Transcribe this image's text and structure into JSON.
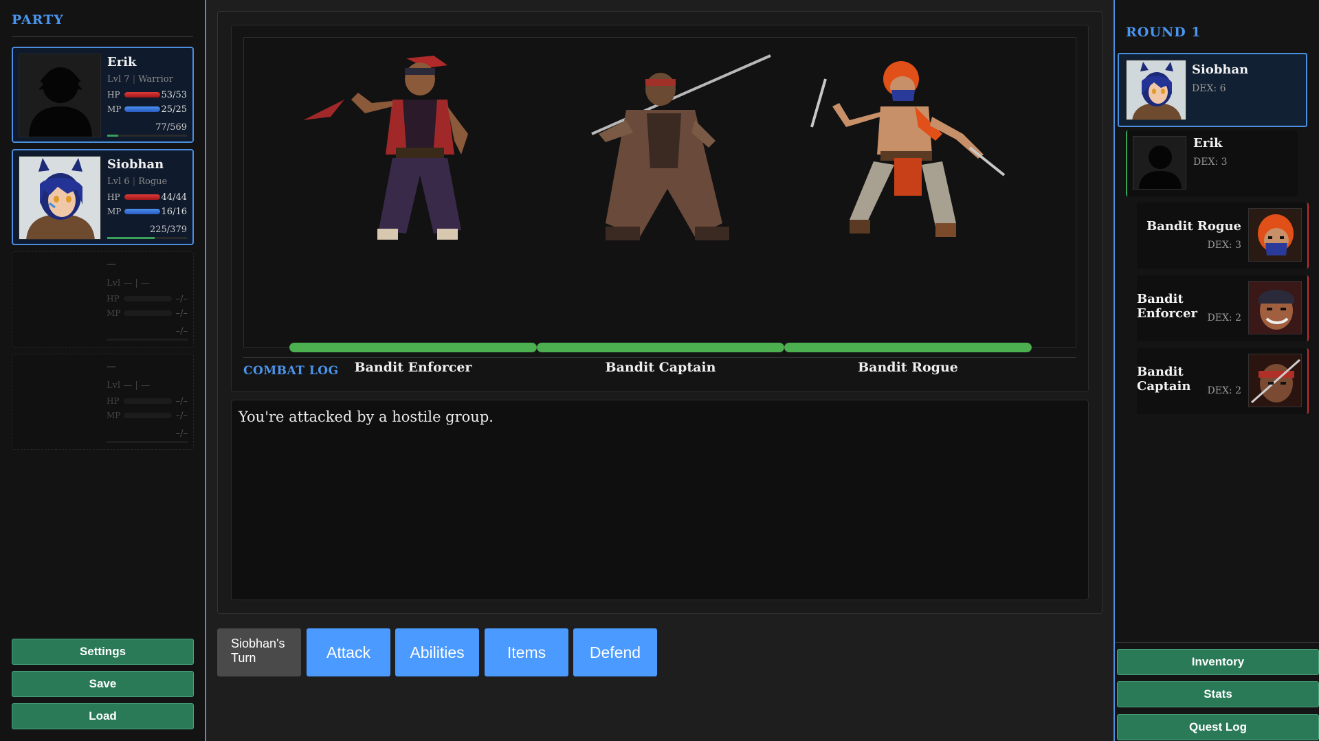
{
  "party": {
    "title": "PARTY",
    "members": [
      {
        "name": "Erik",
        "level": "Lvl 7",
        "class": "Warrior",
        "hp_label": "HP",
        "hp": "53/53",
        "hp_fill": 1.0,
        "mp_label": "MP",
        "mp": "25/25",
        "mp_fill": 1.0,
        "xp": "77/569",
        "xp_fill": 0.135
      },
      {
        "name": "Siobhan",
        "level": "Lvl 6",
        "class": "Rogue",
        "hp_label": "HP",
        "hp": "44/44",
        "hp_fill": 1.0,
        "mp_label": "MP",
        "mp": "16/16",
        "mp_fill": 1.0,
        "xp": "225/379",
        "xp_fill": 0.594
      },
      {
        "name": "—",
        "level": "Lvl —",
        "class": "—",
        "hp_label": "HP",
        "hp": "–/–",
        "mp_label": "MP",
        "mp": "–/–",
        "xp": "–/–"
      },
      {
        "name": "—",
        "level": "Lvl —",
        "class": "—",
        "hp_label": "HP",
        "hp": "–/–",
        "mp_label": "MP",
        "mp": "–/–",
        "xp": "–/–"
      }
    ]
  },
  "left_buttons": {
    "settings": "Settings",
    "save": "Save",
    "load": "Load"
  },
  "enemies": [
    {
      "name": "Bandit Enforcer",
      "hp_fill": 1.0,
      "icon": "bandit-enforcer-sprite"
    },
    {
      "name": "Bandit Captain",
      "hp_fill": 1.0,
      "icon": "bandit-captain-sprite"
    },
    {
      "name": "Bandit Rogue",
      "hp_fill": 1.0,
      "icon": "bandit-rogue-sprite"
    }
  ],
  "combat_log": {
    "title": "COMBAT LOG",
    "lines": [
      "You're attacked by a hostile group."
    ]
  },
  "actions": {
    "turn_label": "Siobhan's Turn",
    "attack": "Attack",
    "abilities": "Abilities",
    "items": "Items",
    "defend": "Defend"
  },
  "turn_order": {
    "round": "ROUND 1",
    "entries": [
      {
        "name": "Siobhan",
        "dex": "DEX: 6"
      },
      {
        "name": "Erik",
        "dex": "DEX: 3"
      },
      {
        "name": "Bandit Rogue",
        "dex": "DEX: 3"
      },
      {
        "name": "Bandit Enforcer",
        "dex": "DEX: 2"
      },
      {
        "name": "Bandit Captain",
        "dex": "DEX: 2"
      }
    ]
  },
  "right_buttons": {
    "inventory": "Inventory",
    "stats": "Stats",
    "quest_log": "Quest Log"
  },
  "colors": {
    "accent": "#4a95ee",
    "button_green": "#2a7a58",
    "action_blue": "#4a9aff",
    "hp_green": "#4caf50",
    "hp_red": "#d02a2a",
    "mp_blue": "#3a7ae0"
  }
}
